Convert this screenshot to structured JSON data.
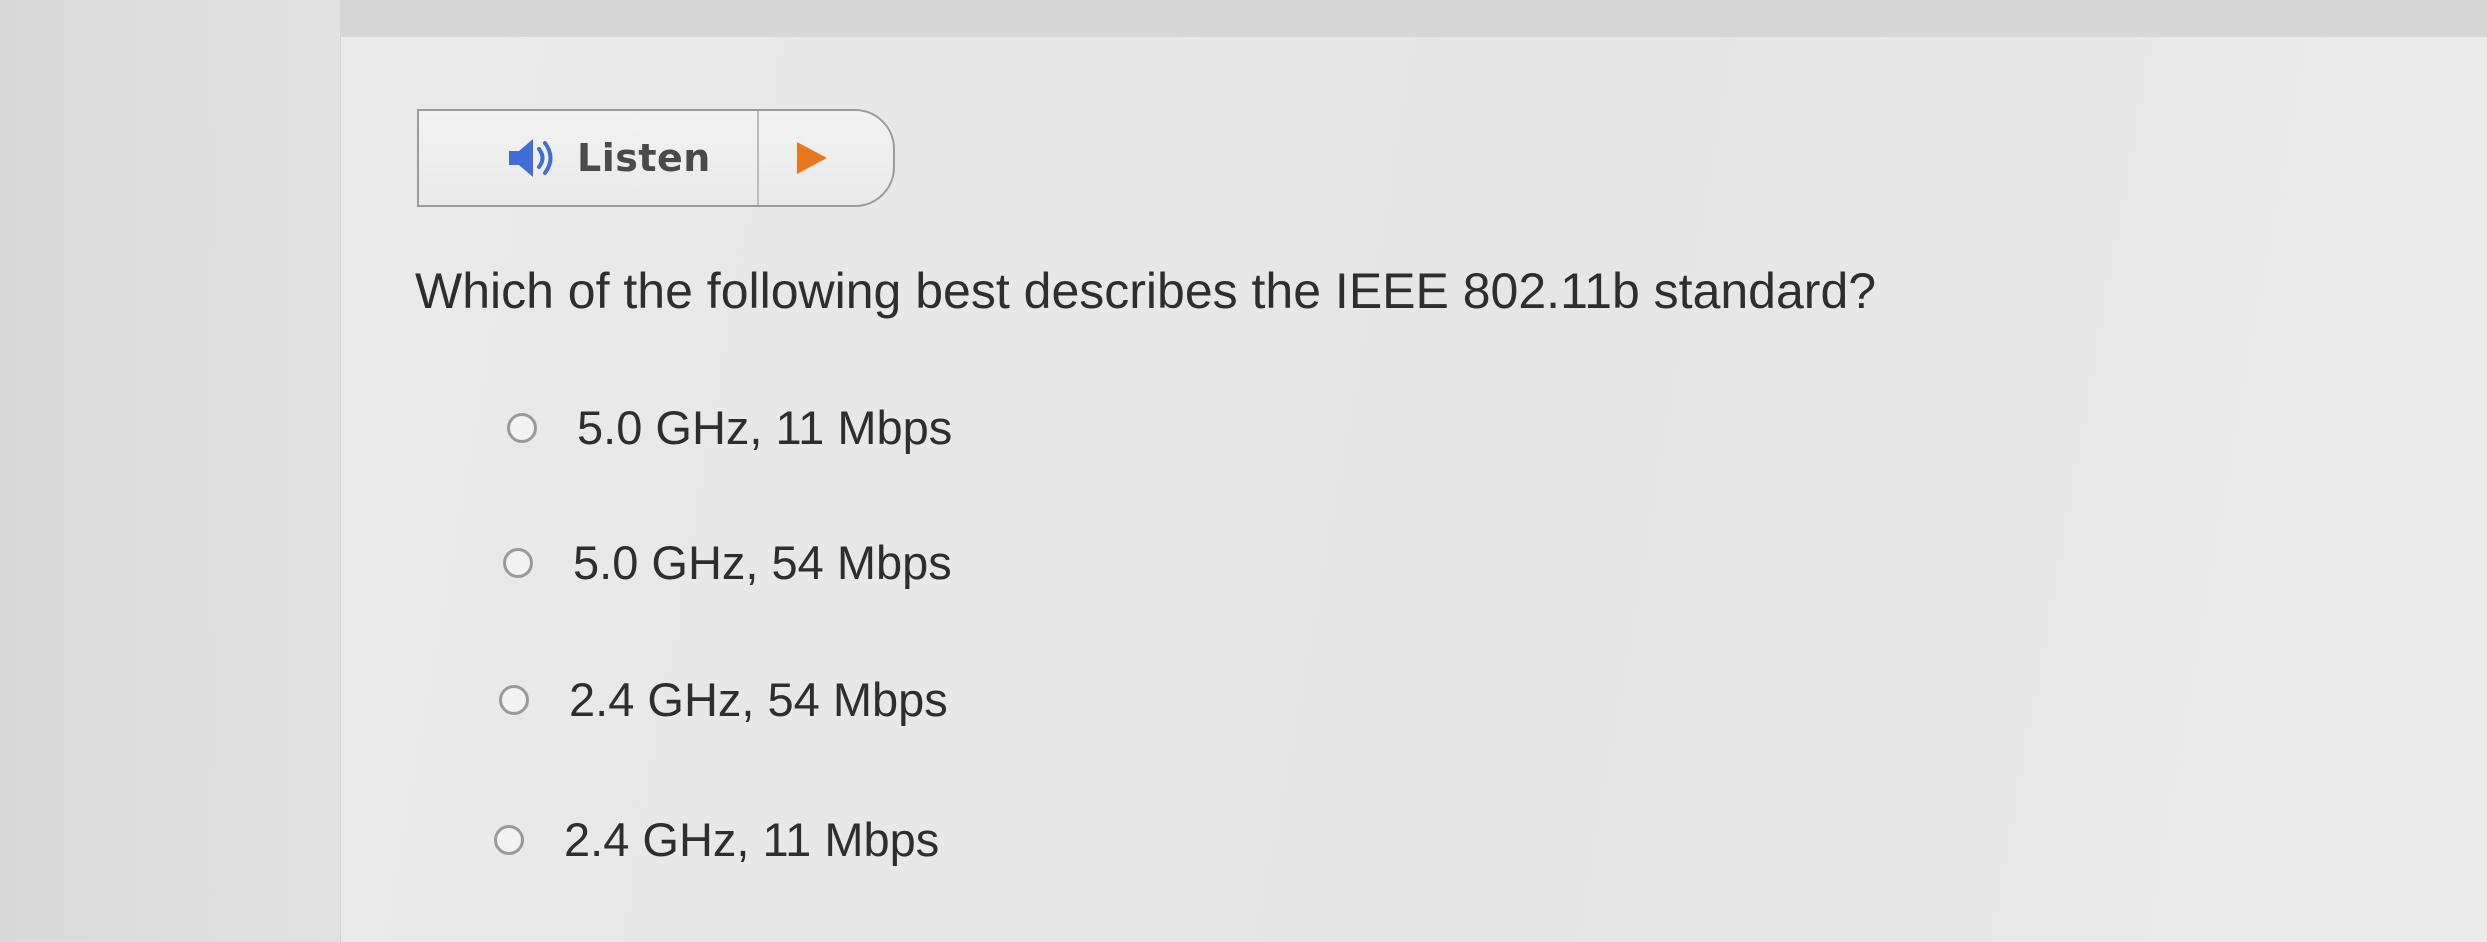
{
  "listen": {
    "label": "Listen",
    "speaker_icon": "speaker-icon",
    "play_icon": "play-icon",
    "speaker_color": "#3f6fd6",
    "play_color": "#e8771e"
  },
  "question": {
    "text": "Which of the following best describes the IEEE 802.11b standard?"
  },
  "options": [
    {
      "label": "5.0 GHz, 11 Mbps",
      "selected": false
    },
    {
      "label": "5.0 GHz, 54 Mbps",
      "selected": false
    },
    {
      "label": "2.4 GHz, 54 Mbps",
      "selected": false
    },
    {
      "label": "2.4 GHz, 11 Mbps",
      "selected": false
    }
  ]
}
